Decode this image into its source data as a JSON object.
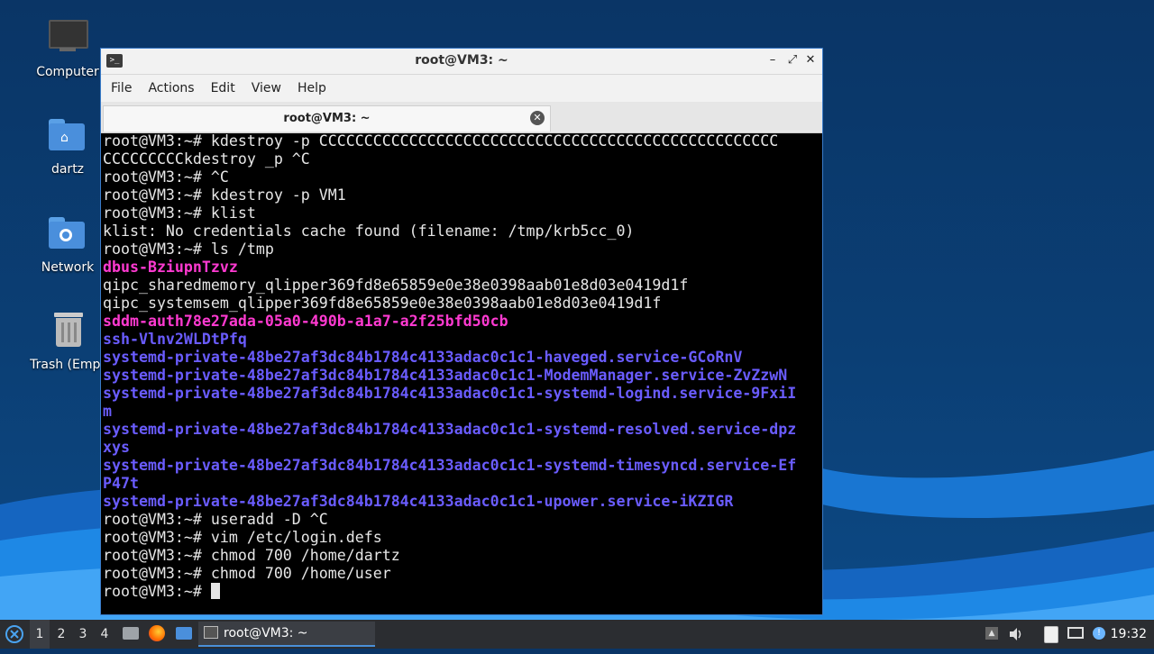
{
  "desktop": {
    "icons": [
      {
        "label": "Computer"
      },
      {
        "label": "dartz"
      },
      {
        "label": "Network"
      },
      {
        "label": "Trash (Empt"
      }
    ]
  },
  "window": {
    "title": "root@VM3: ~",
    "controls": {
      "minimize": "–",
      "maximize": "⤢",
      "close": "✕"
    },
    "menu": [
      "File",
      "Actions",
      "Edit",
      "View",
      "Help"
    ],
    "tab": {
      "label": "root@VM3: ~",
      "close": "✕"
    }
  },
  "terminal": {
    "lines": [
      {
        "text": "root@VM3:~# kdestroy -p CCCCCCCCCCCCCCCCCCCCCCCCCCCCCCCCCCCCCCCCCCCCCCCCCCC",
        "style": "normal"
      },
      {
        "text": "CCCCCCCCCkdestroy _p ^C",
        "style": "normal"
      },
      {
        "text": "root@VM3:~# ^C",
        "style": "normal"
      },
      {
        "text": "root@VM3:~# kdestroy -p VM1",
        "style": "normal"
      },
      {
        "text": "root@VM3:~# klist",
        "style": "normal"
      },
      {
        "text": "klist: No credentials cache found (filename: /tmp/krb5cc_0)",
        "style": "normal"
      },
      {
        "text": "root@VM3:~# ls /tmp",
        "style": "normal"
      },
      {
        "text": "dbus-BziupnTzvz",
        "style": "pink"
      },
      {
        "text": "qipc_sharedmemory_qlipper369fd8e65859e0e38e0398aab01e8d03e0419d1f",
        "style": "normal"
      },
      {
        "text": "qipc_systemsem_qlipper369fd8e65859e0e38e0398aab01e8d03e0419d1f",
        "style": "normal"
      },
      {
        "text": "sddm-auth78e27ada-05a0-490b-a1a7-a2f25bfd50cb",
        "style": "pink"
      },
      {
        "text": "ssh-Vlnv2WLDtPfq",
        "style": "blue"
      },
      {
        "text": "systemd-private-48be27af3dc84b1784c4133adac0c1c1-haveged.service-GCoRnV",
        "style": "blue"
      },
      {
        "text": "systemd-private-48be27af3dc84b1784c4133adac0c1c1-ModemManager.service-ZvZzwN",
        "style": "blue"
      },
      {
        "text": "systemd-private-48be27af3dc84b1784c4133adac0c1c1-systemd-logind.service-9FxiI",
        "style": "blue"
      },
      {
        "text": "m",
        "style": "blue"
      },
      {
        "text": "systemd-private-48be27af3dc84b1784c4133adac0c1c1-systemd-resolved.service-dpz",
        "style": "blue"
      },
      {
        "text": "xys",
        "style": "blue"
      },
      {
        "text": "systemd-private-48be27af3dc84b1784c4133adac0c1c1-systemd-timesyncd.service-Ef",
        "style": "blue"
      },
      {
        "text": "P47t",
        "style": "blue"
      },
      {
        "text": "systemd-private-48be27af3dc84b1784c4133adac0c1c1-upower.service-iKZIGR",
        "style": "blue"
      },
      {
        "text": "root@VM3:~# useradd -D ^C",
        "style": "normal"
      },
      {
        "text": "root@VM3:~# vim /etc/login.defs",
        "style": "normal"
      },
      {
        "text": "root@VM3:~# chmod 700 /home/dartz",
        "style": "normal"
      },
      {
        "text": "root@VM3:~# chmod 700 /home/user",
        "style": "normal"
      }
    ],
    "prompt": "root@VM3:~# "
  },
  "taskbar": {
    "workspaces": [
      "1",
      "2",
      "3",
      "4"
    ],
    "task_label": "root@VM3: ~",
    "clock": "19:32"
  },
  "colors": {
    "pink": "#ff3ad1",
    "blue": "#6a5cff",
    "accent": "#4a90d9"
  }
}
